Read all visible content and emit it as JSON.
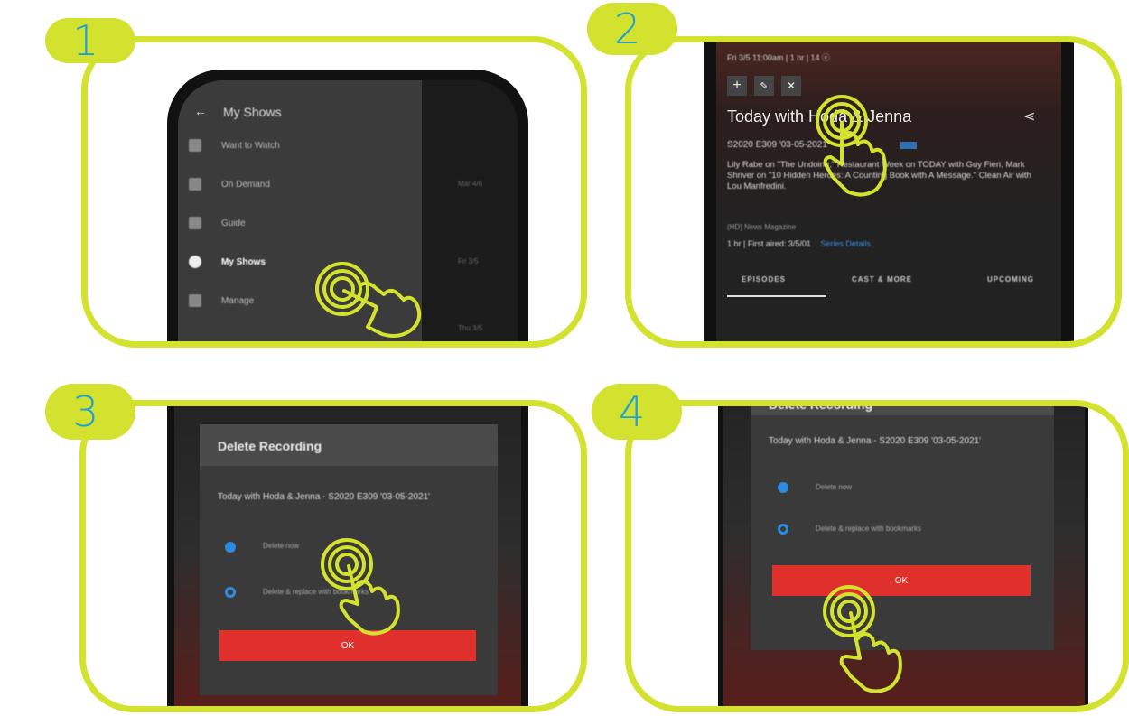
{
  "steps": [
    {
      "number": "1"
    },
    {
      "number": "2"
    },
    {
      "number": "3"
    },
    {
      "number": "4"
    }
  ],
  "panel1": {
    "header_title": "My Shows",
    "menu": [
      "Want to Watch",
      "On Demand",
      "Guide",
      "My Shows",
      "Manage"
    ],
    "times": [
      "Mar 4/6",
      "Fri 3/5",
      "Thu 3/5"
    ]
  },
  "panel2": {
    "meta_line": "Fri 3/5 11:00am | 1 hr | 14 ⓔ",
    "title": "Today with Hoda & Jenna",
    "episode": "S2020 E309 '03-05-2021'",
    "description": "Lily Rabe on \"The Undoing,\" Restaurant Week on TODAY with Guy Fieri, Mark Shriver on \"10 Hidden Heroes: A Counting Book with A Message.\" Clean Air with Lou Manfredini.",
    "genre": "(HD) News Magazine",
    "details_line": "1 hr | First aired: 3/5/01",
    "details_link": "Series Details",
    "tabs": [
      "EPISODES",
      "CAST & MORE",
      "UPCOMING"
    ]
  },
  "panel3": {
    "dialog_title": "Delete Recording",
    "dialog_text": "Today with Hoda & Jenna - S2020 E309 '03-05-2021'",
    "option1": "Delete now",
    "option2": "Delete & replace with bookmarks",
    "ok": "OK"
  },
  "panel4": {
    "dialog_title": "Delete Recording",
    "dialog_text": "Today with Hoda & Jenna - S2020 E309 '03-05-2021'",
    "option1": "Delete now",
    "option2": "Delete & replace with bookmarks",
    "ok": "OK"
  },
  "colors": {
    "accent_lime": "#d3e22e",
    "number_blue": "#1fa0d6",
    "ok_red": "#e0302c",
    "radio_blue": "#2c8be0"
  }
}
